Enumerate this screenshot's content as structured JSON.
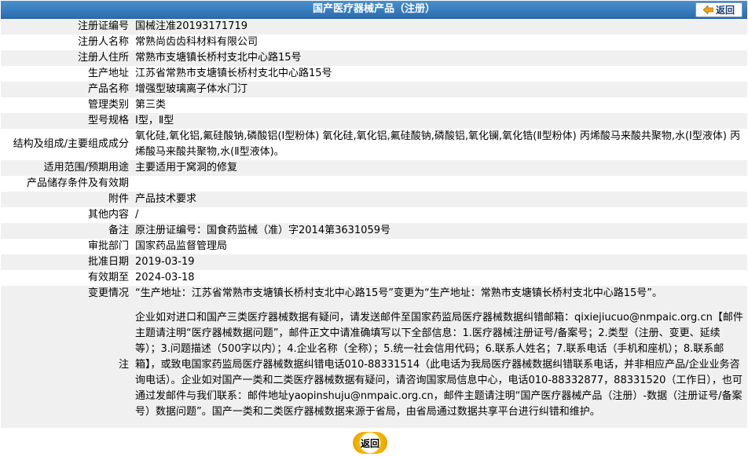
{
  "header": {
    "title": "国产医疗器械产品（注册）",
    "back_label": "返回"
  },
  "rows": [
    {
      "label": "注册证编号",
      "value": "国械注准20193171719"
    },
    {
      "label": "注册人名称",
      "value": "常熟尚齿齿科材料有限公司"
    },
    {
      "label": "注册人住所",
      "value": "常熟市支塘镇长桥村支北中心路15号"
    },
    {
      "label": "生产地址",
      "value": "江苏省常熟市支塘镇长桥村支北中心路15号"
    },
    {
      "label": "产品名称",
      "value": "增强型玻璃离子体水门汀"
    },
    {
      "label": "管理类别",
      "value": "第三类"
    },
    {
      "label": "型号规格",
      "value": "Ⅰ型，Ⅱ型"
    },
    {
      "label": "结构及组成/主要组成成分",
      "value": "氧化硅,氧化铝,氟硅酸钠,磷酸铝(Ⅰ型粉体) 氧化硅,氧化铝,氟硅酸钠,磷酸铝,氧化镧,氧化锆(Ⅱ型粉体) 丙烯酸马来酸共聚物,水(Ⅰ型液体) 丙烯酸马来酸共聚物,水(Ⅱ型液体)。"
    },
    {
      "label": "适用范围/预期用途",
      "value": "主要适用于窝洞的修复"
    },
    {
      "label": "产品储存条件及有效期",
      "value": ""
    },
    {
      "label": "附件",
      "value": "产品技术要求"
    },
    {
      "label": "其他内容",
      "value": "/"
    },
    {
      "label": "备注",
      "value": "原注册证编号：国食药监械（准）字2014第3631059号"
    },
    {
      "label": "审批部门",
      "value": "国家药品监督管理局"
    },
    {
      "label": "批准日期",
      "value": "2019-03-19"
    },
    {
      "label": "有效期至",
      "value": "2024-03-18"
    },
    {
      "label": "变更情况",
      "value": "“生产地址：江苏省常熟市支塘镇长桥村支北中心路15号”变更为“生产地址：常熟市支塘镇长桥村支北中心路15号”。"
    }
  ],
  "notes": {
    "label": "注",
    "text": "企业如对进口和国产三类医疗器械数据有疑问，请发送邮件至国家药监局医疗器械数据纠错邮箱：qixiejiucuo@nmpaic.org.cn【邮件主题请注明“医疗器械数据问题”，邮件正文中请准确填写以下全部信息：1.医疗器械注册证号/备案号；2.类型（注册、变更、延续等）；3.问题描述（500字以内）；4.企业名称（全称）；5.统一社会信用代码；6.联系人姓名；7.联系电话（手机和座机）；8.联系邮箱】，或致电国家药监局医疗器械数据纠错电话010-88331514（此电话为我局医疗器械数据纠错联系电话，并非相应产品/企业业务咨询电话）。企业如对国产一类和二类医疗器械数据有疑问，请咨询国家局信息中心，电话010-88332877，88331520（工作日），也可通过发邮件与我们联系：邮件地址yaopinshuju@nmpaic.org.cn，邮件主题请注明“国产医疗器械产品（注册）-数据（注册证号/备案号）数据问题”。国产一类和二类医疗器械数据来源于省局，由省局通过数据共享平台进行纠错和维护。"
  },
  "footer": {
    "back_label": "返回"
  }
}
